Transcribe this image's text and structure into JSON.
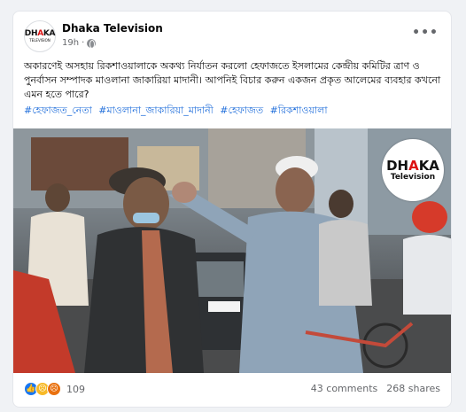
{
  "post": {
    "page_name": "Dhaka Television",
    "time": "19h",
    "avatar_logo": {
      "line1_prefix": "DH",
      "line1_accent": "A",
      "line1_suffix": "KA",
      "line2": "TELEVISION"
    },
    "text": "অকারণেই অসহায় রিকশাওয়ালাকে অকথ্য নির্যাতন করলো হেফাজতে ইসলামের কেন্দ্রীয় কমিটির ত্রাণ ও পুনর্বাসন সম্পাদক মাওলানা জাকারিয়া মাদানী। আপনিই বিচার করুন একজন প্রকৃত আলেমের ব্যবহার কখনো এমন হতে পারে?",
    "hashtags": [
      "#হেফাজত_নেতা",
      "#মাওলানা_জাকারিয়া_মাদানী",
      "#হেফাজত",
      "#রিকশাওয়ালা"
    ],
    "more_icon": "more-options-icon",
    "globe_icon": "globe-icon"
  },
  "media": {
    "watermark_line1_prefix": "DH",
    "watermark_line1_accent": "A",
    "watermark_line1_suffix": "KA",
    "watermark_line2": "Television"
  },
  "stats": {
    "reaction_count": "109",
    "comments": "43 comments",
    "shares": "268 shares",
    "reaction_icons": [
      "like-icon",
      "sad-icon",
      "angry-icon"
    ]
  },
  "colors": {
    "link": "#216fdb",
    "like": "#1877f2",
    "sad": "#f7b928",
    "angry": "#e9710f",
    "brand_red": "#dd1111"
  }
}
